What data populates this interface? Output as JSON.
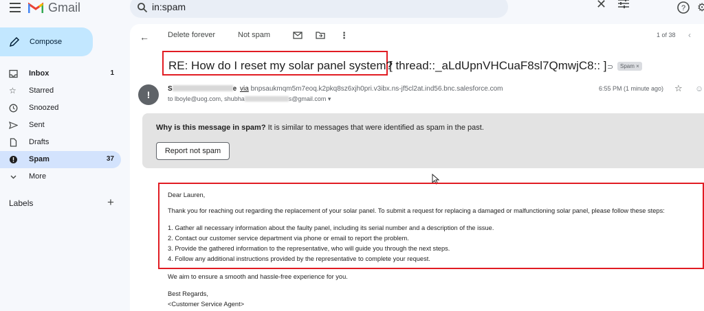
{
  "app": {
    "name": "Gmail"
  },
  "search": {
    "value": "in:spam"
  },
  "compose": {
    "label": "Compose"
  },
  "nav": [
    {
      "label": "Inbox",
      "count": "1",
      "icon": "inbox-icon"
    },
    {
      "label": "Starred",
      "count": "",
      "icon": "star-icon"
    },
    {
      "label": "Snoozed",
      "count": "",
      "icon": "clock-icon"
    },
    {
      "label": "Sent",
      "count": "",
      "icon": "send-icon"
    },
    {
      "label": "Drafts",
      "count": "",
      "icon": "draft-icon"
    },
    {
      "label": "Spam",
      "count": "37",
      "icon": "spam-icon"
    },
    {
      "label": "More",
      "count": "",
      "icon": "chevron-down-icon"
    }
  ],
  "labels": {
    "heading": "Labels"
  },
  "toolbar": {
    "delete_forever": "Delete forever",
    "not_spam": "Not spam",
    "pager": "1 of 38"
  },
  "message": {
    "subject": "RE: How do I reset my solar panel system?",
    "subject_rest": "[ thread::_aLdUpnVHCuaF8sl7QmwjC8:: ]",
    "label_chip": "Spam ×",
    "sender_initial": "S",
    "sender_name_suffix": "e",
    "via_word": "via",
    "via_address": "bnpsaukmqm5m7eoq.k2pkq8sz6xjh0pri.v3ibx.ns-jf5cl2at.ind56.bnc.salesforce.com",
    "to_prefix": "to lboyle@uog.com, shubha",
    "to_suffix": "s@gmail.com",
    "time": "6:55 PM (1 minute ago)"
  },
  "spam_notice": {
    "question": "Why is this message in spam?",
    "reason": " It is similar to messages that were identified as spam in the past.",
    "button": "Report not spam"
  },
  "body": {
    "greeting": "Dear Lauren,",
    "intro": "Thank you for reaching out regarding the replacement of your solar panel. To submit a request for replacing a damaged or malfunctioning solar panel, please follow these steps:",
    "steps": [
      "1. Gather all necessary information about the faulty panel, including its serial number and a description of the issue.",
      "2. Contact our customer service department via phone or email to report the problem.",
      "3. Provide the gathered information to the representative, who will guide you through the next steps.",
      "4. Follow any additional instructions provided by the representative to complete your request."
    ],
    "closing_line": "We aim to ensure a smooth and hassle-free experience for you.",
    "sign_off": "Best Regards,",
    "signature": "<Customer Service Agent>"
  },
  "colors": {
    "highlight_red": "#e11b22",
    "compose_bg": "#c2e7ff",
    "active_nav": "#d3e3fd",
    "spam_panel": "#e3e3e3"
  }
}
